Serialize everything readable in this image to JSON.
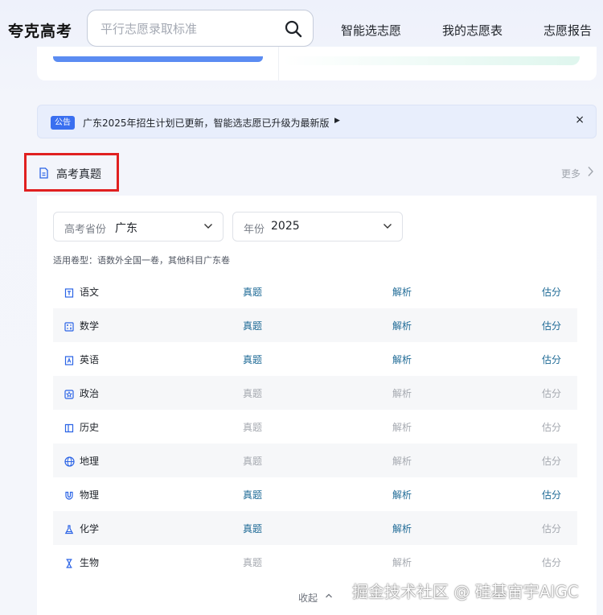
{
  "header": {
    "logo": "夸克高考",
    "search_placeholder": "平行志愿录取标准",
    "nav": [
      "智能选志愿",
      "我的志愿表",
      "志愿报告"
    ]
  },
  "notice": {
    "tag": "公告",
    "text": "广东2025年招生计划已更新，智能选志愿已升级为最新版",
    "close": "×"
  },
  "section": {
    "title": "高考真题",
    "more": "更多"
  },
  "filters": {
    "province": {
      "label": "高考省份",
      "value": "广东"
    },
    "year": {
      "label": "年份",
      "value": "2025"
    }
  },
  "note": "适用卷型：语数外全国一卷，其他科目广东卷",
  "column_labels": {
    "exam": "真题",
    "analysis": "解析",
    "score": "估分"
  },
  "subjects": [
    {
      "name": "语文",
      "icon": "doc-icon",
      "exam": true,
      "analysis": true,
      "score": true
    },
    {
      "name": "数学",
      "icon": "calculator-icon",
      "exam": true,
      "analysis": true,
      "score": true
    },
    {
      "name": "英语",
      "icon": "letter-a-icon",
      "exam": true,
      "analysis": true,
      "score": true
    },
    {
      "name": "政治",
      "icon": "star-badge-icon",
      "exam": false,
      "analysis": false,
      "score": false
    },
    {
      "name": "历史",
      "icon": "book-icon",
      "exam": false,
      "analysis": false,
      "score": false
    },
    {
      "name": "地理",
      "icon": "globe-icon",
      "exam": false,
      "analysis": false,
      "score": false
    },
    {
      "name": "物理",
      "icon": "magnet-icon",
      "exam": true,
      "analysis": true,
      "score": true
    },
    {
      "name": "化学",
      "icon": "flask-icon",
      "exam": true,
      "analysis": true,
      "score": false
    },
    {
      "name": "生物",
      "icon": "hourglass-icon",
      "exam": false,
      "analysis": false,
      "score": false
    }
  ],
  "collapse_label": "收起",
  "watermark": "掘金技术社区 @ 硅基宙宇AIGC",
  "colors": {
    "active_link": "#1e6a96",
    "disabled_link": "#a5a9b0",
    "accent": "#3a6ff0",
    "highlight_box": "#e02020"
  }
}
